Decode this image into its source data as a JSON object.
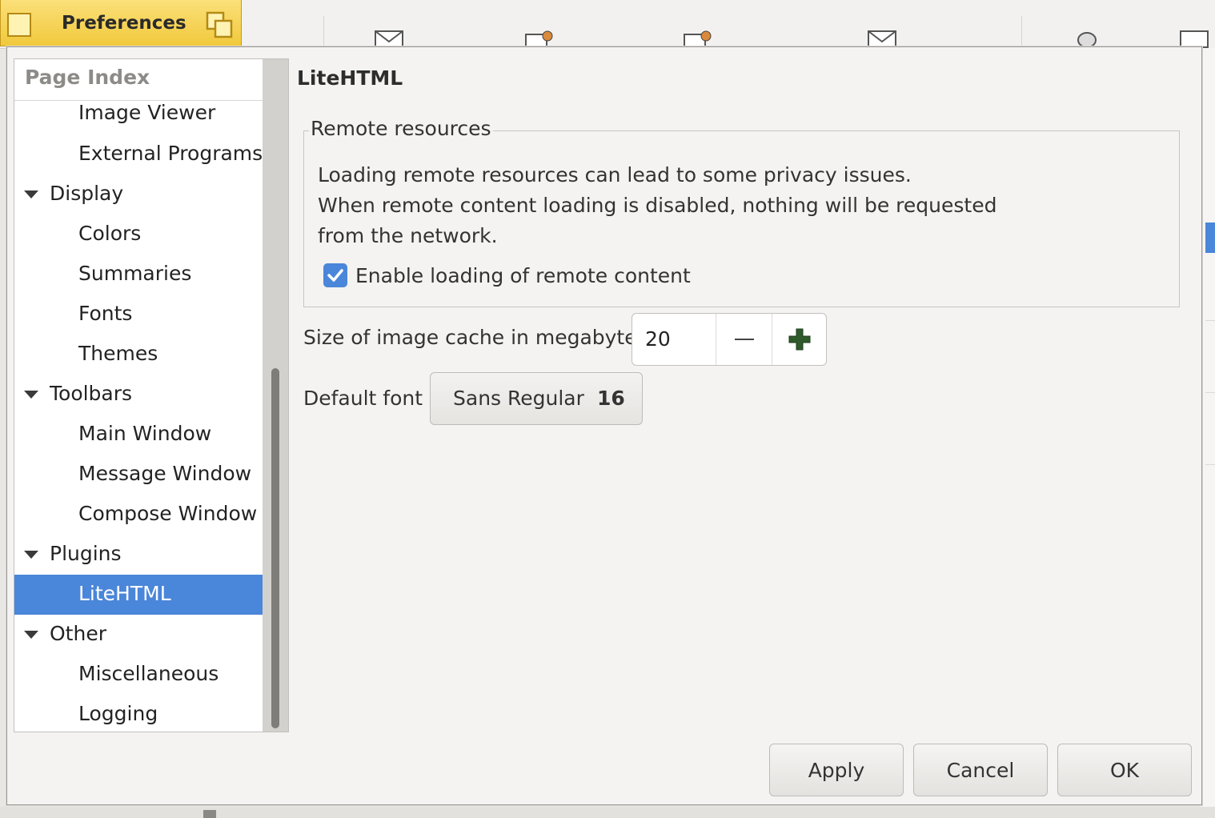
{
  "window": {
    "title": "Preferences"
  },
  "sidebar": {
    "header": "Page Index",
    "items": [
      {
        "label": "Image Viewer",
        "level": "child"
      },
      {
        "label": "External Programs",
        "level": "child"
      },
      {
        "label": "Display",
        "level": "parent"
      },
      {
        "label": "Colors",
        "level": "child"
      },
      {
        "label": "Summaries",
        "level": "child"
      },
      {
        "label": "Fonts",
        "level": "child"
      },
      {
        "label": "Themes",
        "level": "child"
      },
      {
        "label": "Toolbars",
        "level": "parent"
      },
      {
        "label": "Main Window",
        "level": "child"
      },
      {
        "label": "Message Window",
        "level": "child"
      },
      {
        "label": "Compose Window",
        "level": "child"
      },
      {
        "label": "Plugins",
        "level": "parent"
      },
      {
        "label": "LiteHTML",
        "level": "child",
        "selected": true
      },
      {
        "label": "Other",
        "level": "parent"
      },
      {
        "label": "Miscellaneous",
        "level": "child"
      },
      {
        "label": "Logging",
        "level": "child"
      }
    ]
  },
  "page": {
    "title": "LiteHTML",
    "remote": {
      "legend": "Remote resources",
      "line1": "Loading remote resources can lead to some privacy issues.",
      "line2": "When remote content loading is disabled, nothing will be requested",
      "line3": "from the network.",
      "checkbox_label": "Enable loading of remote content",
      "checkbox_checked": true
    },
    "cache": {
      "label": "Size of image cache in megabytes",
      "value": "20"
    },
    "font": {
      "label": "Default font",
      "name": "Sans Regular",
      "size": "16"
    }
  },
  "buttons": {
    "apply": "Apply",
    "cancel": "Cancel",
    "ok": "OK"
  },
  "colors": {
    "accent": "#4a86d9",
    "title_bar": "#f1c93c"
  }
}
